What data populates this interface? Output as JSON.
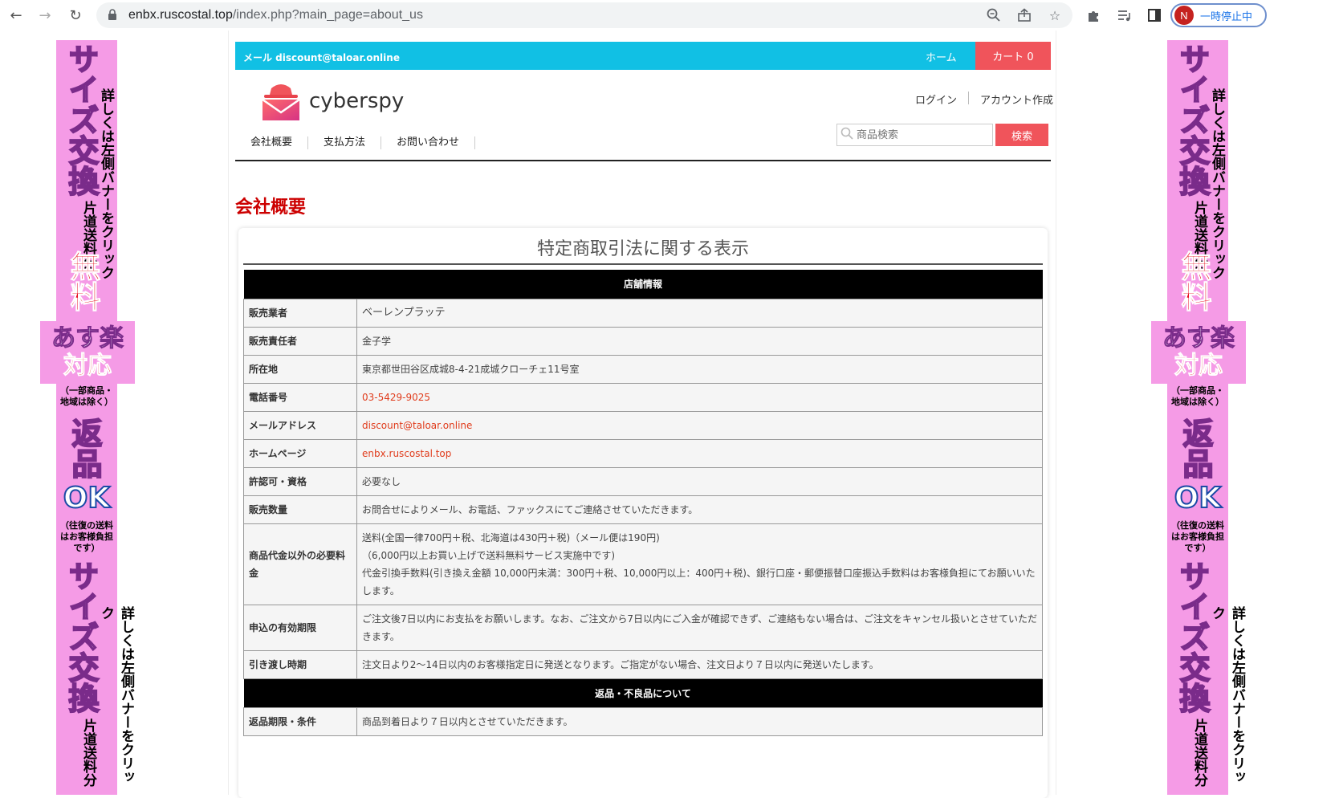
{
  "browser": {
    "url_host": "enbx.ruscostal.top",
    "url_path": "/index.php?main_page=about_us",
    "profile_initial": "N",
    "profile_status": "一時停止中"
  },
  "banner": {
    "big1": "サイズ交換",
    "small1": "詳しくは左側バナーをクリック",
    "small2": "片道送料分",
    "free": "無料",
    "box_line1": "あす楽",
    "box_line2": "対応",
    "box_note": "（一部商品・地域は除く）",
    "return_text": "返品",
    "ok_text": "OK",
    "ok_note": "（往復の送料はお客様負担です）"
  },
  "topbar": {
    "mail": "メール discount@taloar.online",
    "home": "ホーム",
    "cart": "カート 0"
  },
  "logo": {
    "name": "cyberspy"
  },
  "account": {
    "login": "ログイン",
    "create": "アカウント作成"
  },
  "search": {
    "placeholder": "商品検索",
    "button": "検索"
  },
  "menu": [
    "会社概要",
    "支払方法",
    "お問い合わせ"
  ],
  "page_title": "会社概要",
  "card_title": "特定商取引法に関する表示",
  "sections": {
    "shop": "店舗情報",
    "returns": "返品・不良品について"
  },
  "rows": [
    {
      "label": "販売業者",
      "value": "ベーレンプラッテ"
    },
    {
      "label": "販売責任者",
      "value": "金子学"
    },
    {
      "label": "所在地",
      "value": "東京都世田谷区成城8-4-21成城クローチェ11号室"
    },
    {
      "label": "電話番号",
      "value": "03-5429-9025"
    },
    {
      "label": "メールアドレス",
      "value": "discount@taloar.online"
    },
    {
      "label": "ホームページ",
      "value": "enbx.ruscostal.top"
    },
    {
      "label": "許認可・資格",
      "value": "必要なし"
    },
    {
      "label": "販売数量",
      "value": "お問合せによりメール、お電話、ファックスにてご連絡させていただきます。"
    },
    {
      "label": "商品代金以外の必要料金",
      "value1": "送料(全国一律700円＋税、北海道は430円＋税)（メール便は190円)",
      "value2": "（6,000円以上お買い上げで送料無料サービス実施中です)",
      "value3": "代金引換手数料(引き換え金額 10,000円未満：300円＋税、10,000円以上：400円＋税)、銀行口座・郵便振替口座振込手数料はお客様負担にてお願いいたします。"
    },
    {
      "label": "申込の有効期限",
      "value": "ご注文後7日以内にお支払をお願いします。なお、ご注文から7日以内にご入金が確認できず、ご連絡もない場合は、ご注文をキャンセル扱いとさせていただきます。"
    },
    {
      "label": "引き渡し時期",
      "value": "注文日より2～14日以内のお客様指定日に発送となります。ご指定がない場合、注文日より７日以内に発送いたします。"
    },
    {
      "label": "返品期限・条件",
      "value": "商品到着日より７日以内とさせていただきます。"
    }
  ]
}
